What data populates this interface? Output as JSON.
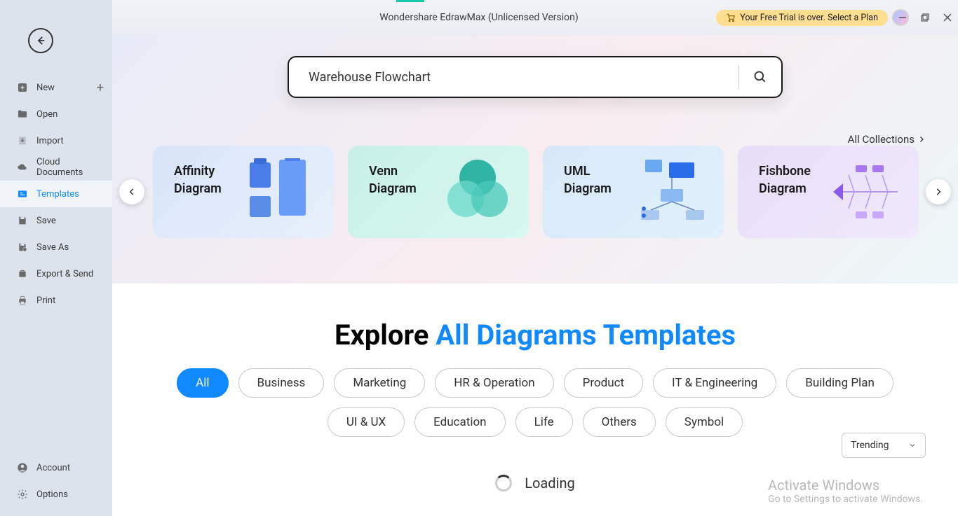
{
  "app": {
    "title": "Wondershare EdrawMax (Unlicensed Version)"
  },
  "trial": {
    "text": "Your Free Trial is over. Select a Plan"
  },
  "sidebar": {
    "items": [
      {
        "label": "New"
      },
      {
        "label": "Open"
      },
      {
        "label": "Import"
      },
      {
        "label": "Cloud Documents"
      },
      {
        "label": "Templates"
      },
      {
        "label": "Save"
      },
      {
        "label": "Save As"
      },
      {
        "label": "Export & Send"
      },
      {
        "label": "Print"
      }
    ],
    "bottom": [
      {
        "label": "Account"
      },
      {
        "label": "Options"
      }
    ]
  },
  "search": {
    "value": "Warehouse Flowchart"
  },
  "collections_link": "All Collections",
  "cards": [
    {
      "title": "Affinity\nDiagram"
    },
    {
      "title": "Venn\nDiagram"
    },
    {
      "title": "UML\nDiagram"
    },
    {
      "title": "Fishbone\nDiagram"
    }
  ],
  "explore": {
    "prefix": "Explore ",
    "accent": "All Diagrams Templates"
  },
  "chips": [
    "All",
    "Business",
    "Marketing",
    "HR & Operation",
    "Product",
    "IT & Engineering",
    "Building Plan",
    "UI & UX",
    "Education",
    "Life",
    "Others",
    "Symbol"
  ],
  "sort": {
    "selected": "Trending"
  },
  "loading": "Loading",
  "watermark": {
    "title": "Activate Windows",
    "subtitle": "Go to Settings to activate Windows."
  }
}
